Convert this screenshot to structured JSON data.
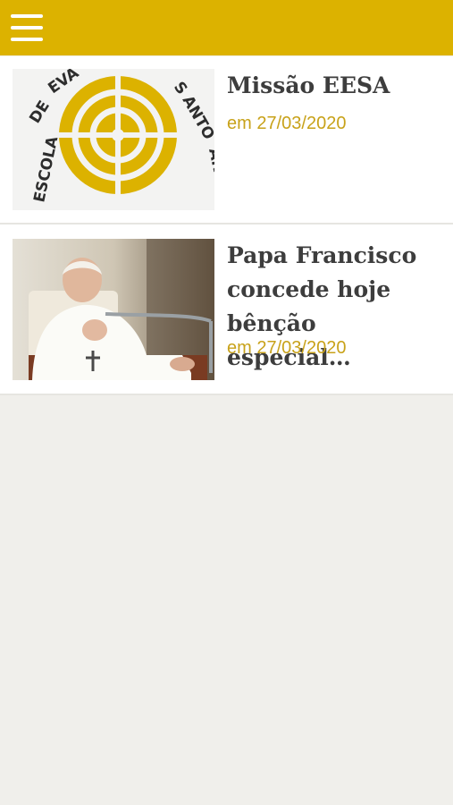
{
  "header": {
    "menu_icon": "hamburger-menu-icon",
    "color": "#dcb200"
  },
  "feed": {
    "items": [
      {
        "title": "Missão EESA",
        "date": "em 27/03/2020",
        "thumbnail": {
          "type": "logo",
          "ring_text": "ESCOLA DE EVA… SANTO ANDRÉ"
        }
      },
      {
        "title": "Papa Francisco concede hoje bênção especial…",
        "date": "em 27/03/2020",
        "thumbnail": {
          "type": "photo"
        }
      }
    ]
  },
  "colors": {
    "accent": "#dcb200",
    "date_text": "#c8a21a",
    "title_text": "#3d3d3d",
    "background": "#f0efeb"
  }
}
